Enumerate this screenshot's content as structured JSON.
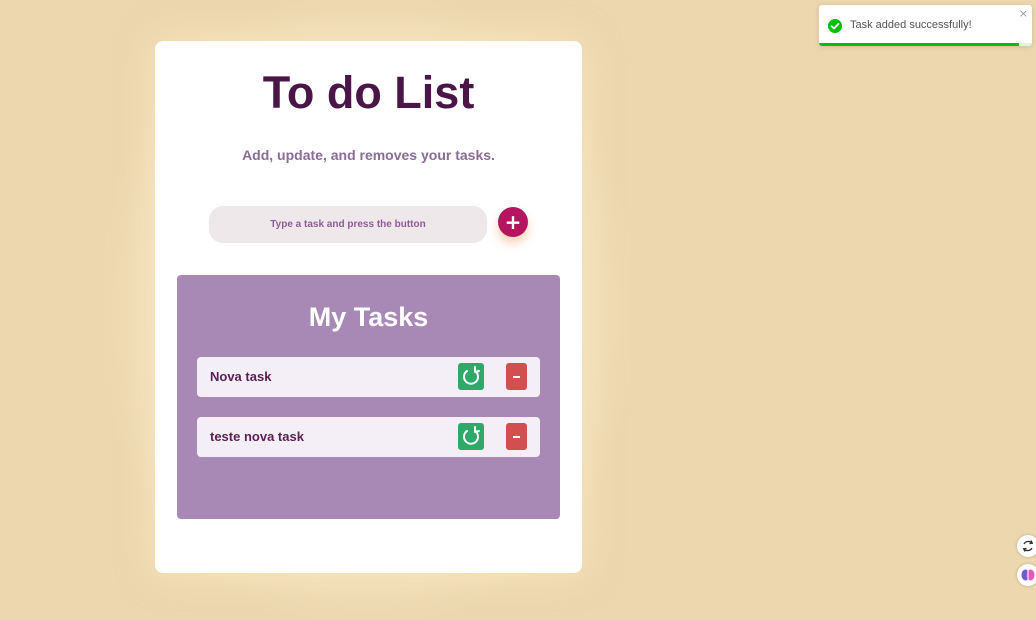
{
  "app": {
    "title": "To do List",
    "subtitle": "Add, update, and removes your tasks."
  },
  "input": {
    "placeholder": "Type a task and press the button",
    "value": ""
  },
  "add_button": {
    "label": "+"
  },
  "tasks": {
    "heading": "My Tasks",
    "items": [
      {
        "text": "Nova task"
      },
      {
        "text": "teste nova task"
      }
    ]
  },
  "toast": {
    "message": "Task added successfully!",
    "close_label": "×",
    "progress": 0.94,
    "icon": "check-circle-icon"
  },
  "icons": {
    "update": "refresh-icon",
    "remove": "minus-icon",
    "ext_1": "refresh-arrows-icon",
    "ext_2": "brain-icon"
  },
  "colors": {
    "background": "#ecd7ae",
    "title": "#4a1547",
    "accent": "#b5145f",
    "panel": "#a889b6",
    "update": "#2fa86a",
    "remove": "#d14f4f",
    "success": "#07bc0c"
  }
}
